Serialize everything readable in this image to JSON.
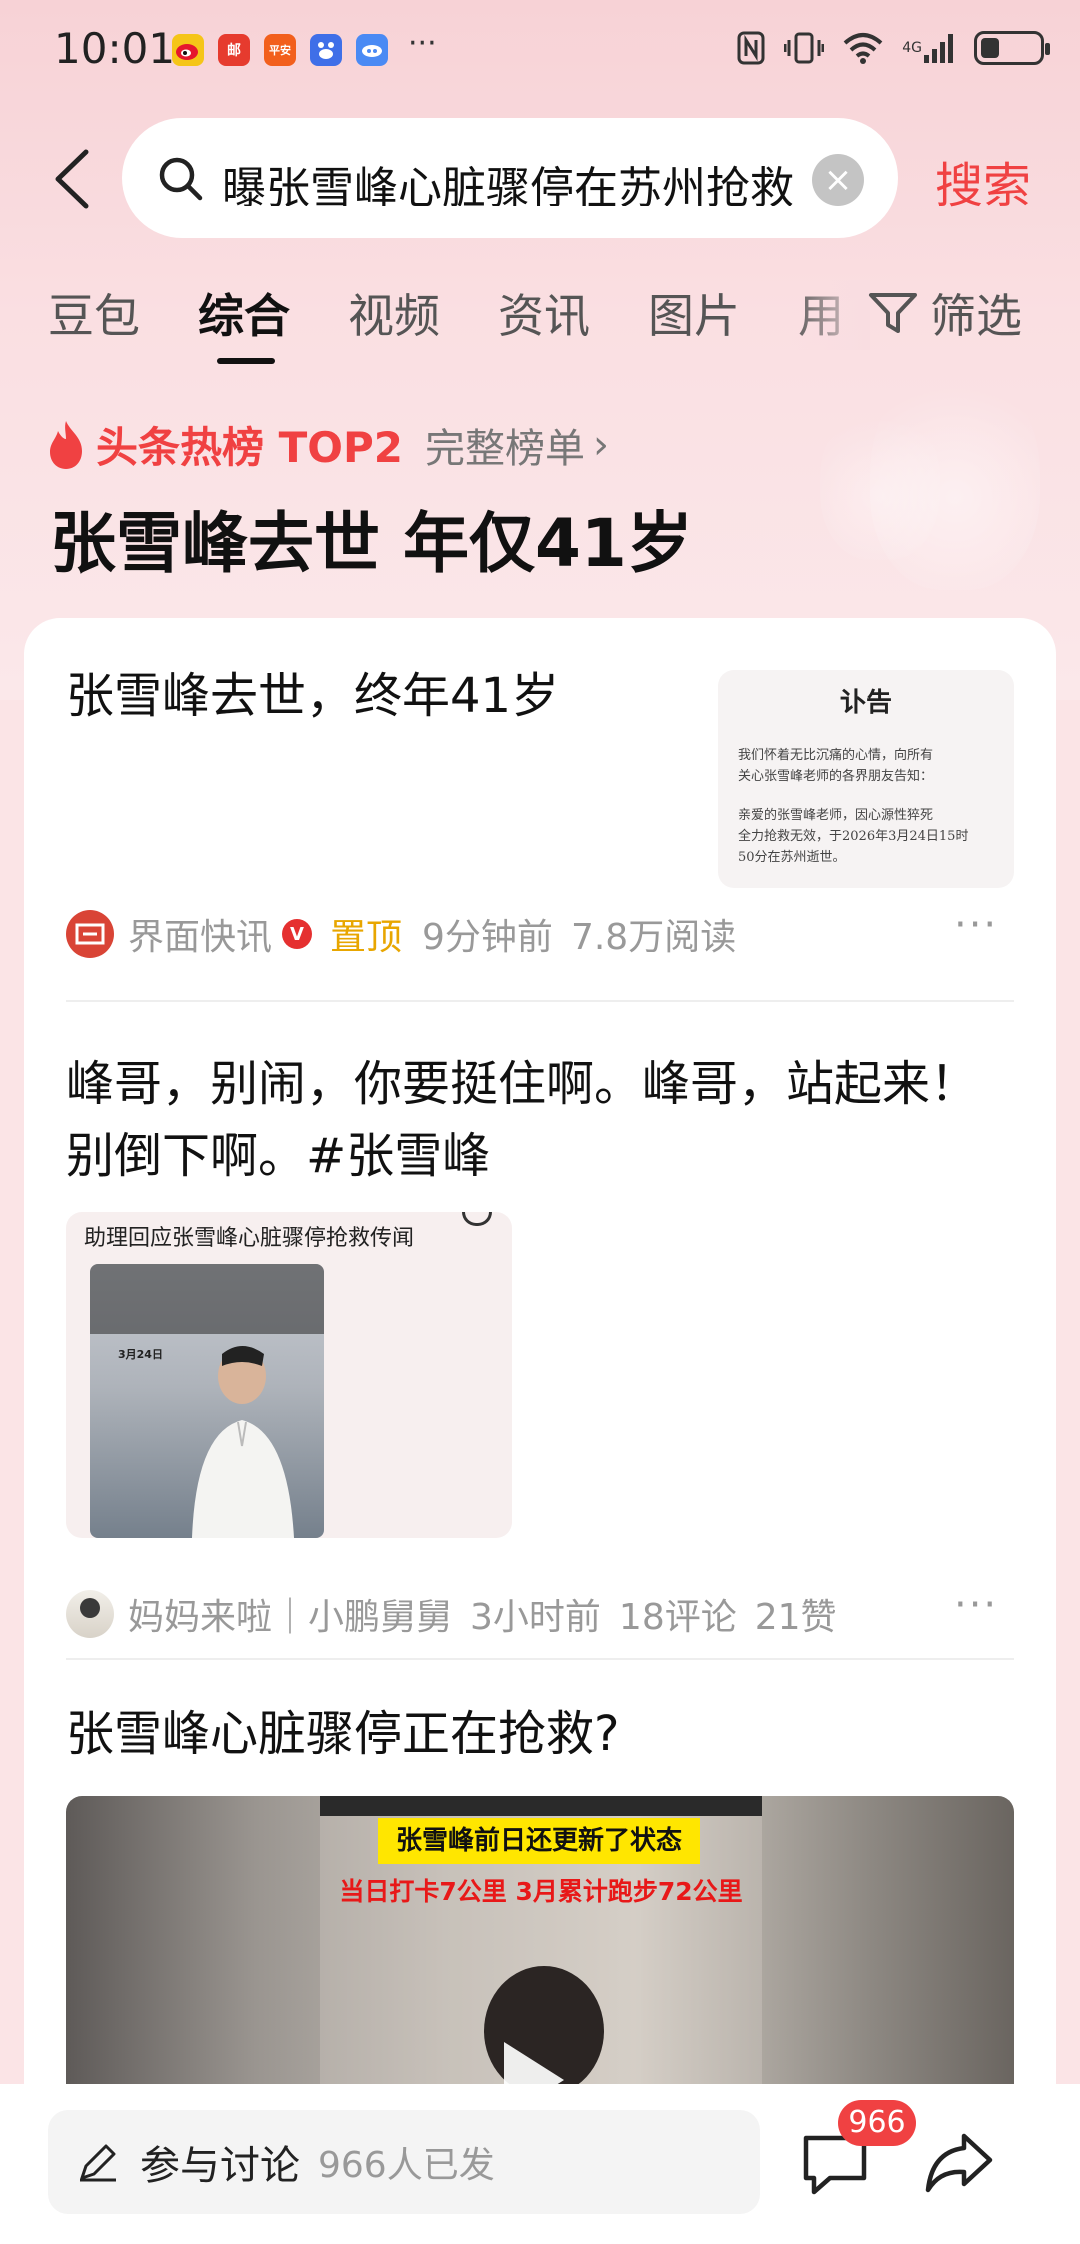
{
  "status_bar": {
    "time": "10:01",
    "apps": [
      {
        "icon": "weibo-icon",
        "label": "",
        "color": "#f5c518"
      },
      {
        "icon": "post-icon",
        "label": "邮",
        "color": "#e63b2e"
      },
      {
        "icon": "pingan-bank-icon",
        "label": "平安",
        "color": "#f25f1c"
      },
      {
        "icon": "baidu-icon",
        "label": "",
        "color": "#3f6fe8"
      },
      {
        "icon": "baidu-netdisk-icon",
        "label": "",
        "color": "#4a8af4"
      }
    ],
    "more": "···",
    "network": "4G"
  },
  "search": {
    "query": "曝张雪峰心脏骤停在苏州抢救",
    "submit_label": "搜索"
  },
  "tabs": [
    {
      "label": "豆包",
      "active": false
    },
    {
      "label": "综合",
      "active": true
    },
    {
      "label": "视频",
      "active": false
    },
    {
      "label": "资讯",
      "active": false
    },
    {
      "label": "图片",
      "active": false
    },
    {
      "label": "用",
      "active": false
    }
  ],
  "filter_label": "筛选",
  "hot": {
    "label": "头条热榜 TOP2",
    "full_list": "完整榜单",
    "title": "张雪峰去世 年仅41岁"
  },
  "results": {
    "item1": {
      "title": "张雪峰去世，终年41岁",
      "notice": {
        "heading": "讣告",
        "p1": [
          "我们怀着无比沉痛的心情，向所有",
          "关心张雪峰老师的各界朋友告知："
        ],
        "p2": [
          "亲爱的张雪峰老师，因心源性猝死",
          "全力抢救无效，于2026年3月24日15时",
          "50分在苏州逝世。"
        ]
      },
      "source": "界面快讯",
      "verified": "V",
      "pinned": "置顶",
      "time": "9分钟前",
      "reads": "7.8万阅读"
    },
    "item2": {
      "title_line1": "峰哥，别闹，你要挺住啊。峰哥，站起来！",
      "title_line2": "别倒下啊。#张雪峰",
      "thumb_caption": "助理回应张雪峰心脏骤停抢救传闻",
      "thumb_date": "3月24日",
      "source": "妈妈来啦｜小鹏舅舅",
      "time": "3小时前",
      "comments": "18评论",
      "likes": "21赞"
    },
    "item3": {
      "title": "张雪峰心脏骤停正在抢救?",
      "video_banner": "张雪峰前日还更新了状态",
      "video_subtitle": "当日打卡7公里 3月累计跑步72公里"
    }
  },
  "bottom_bar": {
    "comment_label": "参与讨论",
    "comment_count": "966人已发",
    "badge": "966"
  },
  "colors": {
    "accent": "#f04142",
    "pinned": "#e8a600",
    "background": "#fbe4e6"
  }
}
